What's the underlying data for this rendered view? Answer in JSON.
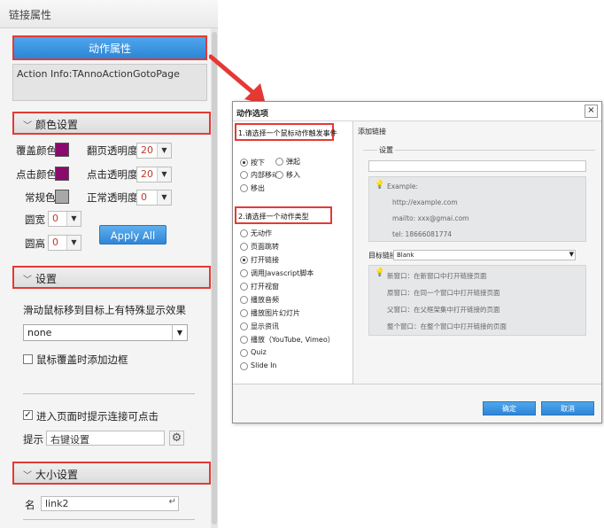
{
  "panel": {
    "title": "链接属性",
    "action_button": "动作属性",
    "action_info": "Action Info:TAnnoActionGotoPage"
  },
  "color_section": {
    "title": "颜色设置",
    "overlay_color_label": "覆盖颜色",
    "flip_opacity_label": "翻页透明度",
    "flip_opacity_value": "20",
    "click_color_label": "点击颜色",
    "click_opacity_label": "点击透明度",
    "click_opacity_value": "20",
    "normal_color_label": "常规色",
    "normal_opacity_label": "正常透明度",
    "normal_opacity_value": "0",
    "radius_w_label": "圆宽",
    "radius_w_value": "0",
    "radius_h_label": "圆高",
    "radius_h_value": "0",
    "apply_all": "Apply All",
    "colors": {
      "overlay": "#8b0a6e",
      "click": "#8b0a6e",
      "normal": "#a8a8a8"
    }
  },
  "settings_section": {
    "title": "设置",
    "hover_effect_label": "滑动鼠标移到目标上有特殊显示效果",
    "hover_effect_value": "none",
    "border_on_hover": "鼠标覆盖时添加边框",
    "show_clickable": "进入页面时提示连接可点击",
    "hint_label": "提示",
    "hint_value": "右键设置"
  },
  "size_section": {
    "title": "大小设置",
    "name_label": "名",
    "name_value": "link2"
  },
  "dialog": {
    "title": "动作选项",
    "close": "×",
    "trigger_heading": "1.请选择一个鼠标动作触发事件",
    "triggers": [
      "按下",
      "弹起",
      "内部移动",
      "移入",
      "移出"
    ],
    "action_heading": "2.请选择一个动作类型",
    "actions": [
      "无动作",
      "页面跳转",
      "打开链接",
      "调用Javascript脚本",
      "打开视窗",
      "播放音频",
      "播放图片幻灯片",
      "显示资讯",
      "播放（YouTube, Vimeo）",
      "Quiz",
      "Slide In"
    ],
    "right_title": "添加链接",
    "fieldset_label": "设置",
    "example_label": "Example:",
    "examples": [
      "http://example.com",
      "mailto: xxx@gmai.com",
      "tel: 18666081774"
    ],
    "target_label": "目标链接",
    "target_value": "Blank",
    "targets": [
      "新窗口：在新窗口中打开链接页面",
      "原窗口：在同一个窗口中打开链接页面",
      "父窗口：在父框架集中打开链接的页面",
      "整个窗口：在整个窗口中打开链接的页面"
    ],
    "ok": "确定",
    "cancel": "取消"
  }
}
